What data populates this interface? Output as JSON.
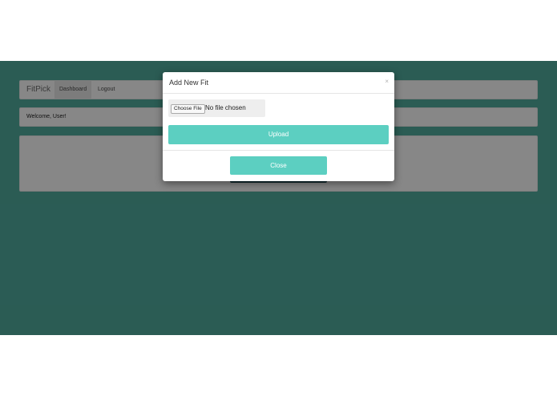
{
  "navbar": {
    "brand": "FitPick",
    "items": [
      {
        "label": "Dashboard",
        "active": true
      },
      {
        "label": "Logout",
        "active": false
      }
    ]
  },
  "welcome": {
    "text": "Welcome, User!"
  },
  "modal": {
    "title": "Add New Fit",
    "close_icon": "×",
    "file_input": {
      "button_label": "Choose File",
      "status": "No file chosen"
    },
    "upload_label": "Upload",
    "close_label": "Close"
  },
  "colors": {
    "app_background": "#4fa89a",
    "accent": "#5ccfc1",
    "dark_button": "#1f4d55"
  }
}
